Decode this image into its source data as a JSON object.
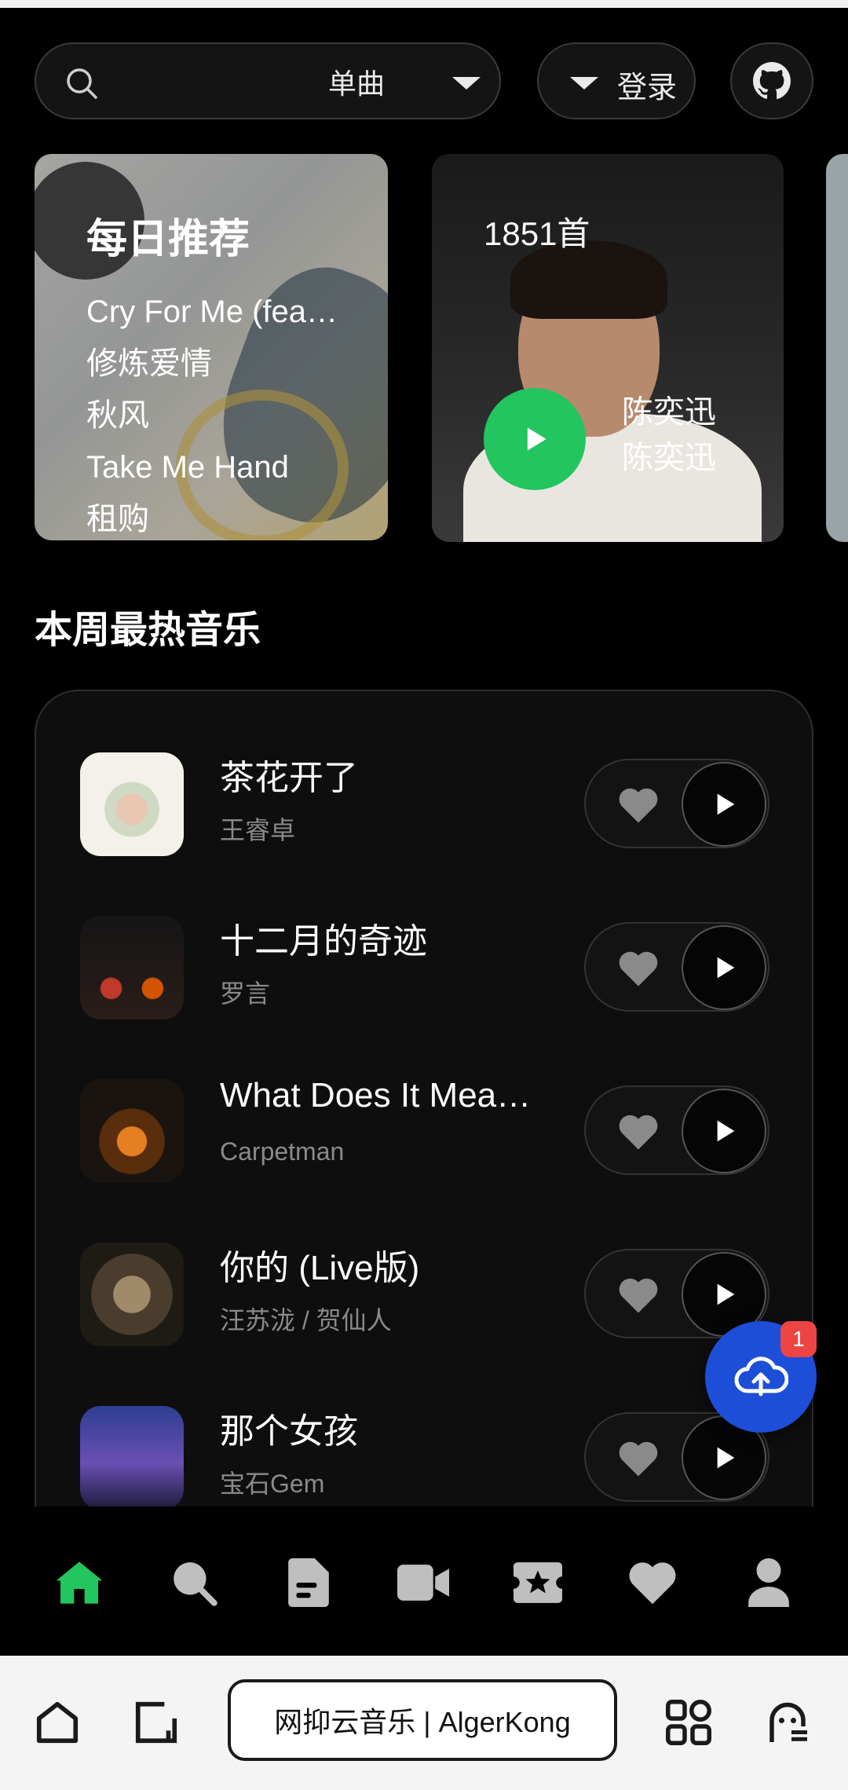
{
  "search": {
    "type_label": "单曲"
  },
  "header": {
    "login_label": "登录"
  },
  "daily": {
    "title": "每日推荐",
    "songs": [
      "Cry For Me (feat. Ami)",
      "修炼爱情",
      "秋风",
      "Take Me Hand",
      "租购"
    ]
  },
  "artist_card": {
    "count": "1851首",
    "name_line1": "陈奕迅",
    "name_line2": "陈奕迅"
  },
  "section": {
    "title": "本周最热音乐"
  },
  "songs": [
    {
      "title": "茶花开了",
      "artist": "王睿卓"
    },
    {
      "title": "十二月的奇迹",
      "artist": "罗言"
    },
    {
      "title": "What Does It Mean To You",
      "artist": "Carpetman"
    },
    {
      "title": "你的 (Live版)",
      "artist": "汪苏泷 / 贺仙人"
    },
    {
      "title": "那个女孩",
      "artist": "宝石Gem"
    }
  ],
  "upload": {
    "badge": "1"
  },
  "browser": {
    "url_title": "网抑云音乐 | AlgerKong"
  },
  "colors": {
    "accent_green": "#22c55e",
    "fab_blue": "#1d4ed8",
    "badge_red": "#ef4444"
  },
  "nav_icons": [
    "home-icon",
    "search-icon",
    "document-icon",
    "video-icon",
    "ticket-star-icon",
    "heart-icon",
    "user-icon"
  ]
}
